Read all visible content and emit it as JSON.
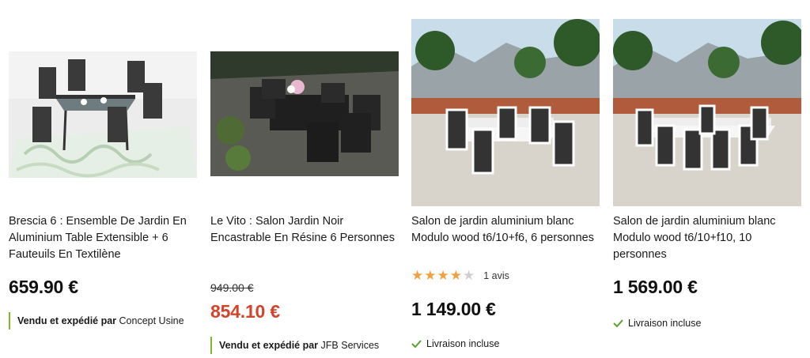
{
  "products": [
    {
      "title": "Brescia 6 : Ensemble De Jardin En Aluminium Table Extensible + 6 Fauteuils En Textilène",
      "price": "659.90 €",
      "seller_prefix": "Vendu et expédié par",
      "seller_name": "Concept Usine"
    },
    {
      "title": "Le Vito : Salon Jardin Noir Encastrable En Résine 6 Personnes",
      "old_price": "949.00 €",
      "price": "854.10 €",
      "seller_prefix": "Vendu et expédié par",
      "seller_name": "JFB Services"
    },
    {
      "title": "Salon de jardin aluminium blanc Modulo wood t6/10+f6, 6 personnes",
      "rating": 4,
      "rating_max": 5,
      "reviews": "1 avis",
      "price": "1 149.00 €",
      "delivery": "Livraison incluse"
    },
    {
      "title": "Salon de jardin aluminium blanc Modulo wood t6/10+f10, 10 personnes",
      "price": "1 569.00 €",
      "delivery": "Livraison incluse"
    }
  ],
  "colors": {
    "sale": "#d2442c",
    "seller_bar": "#7dbb2a",
    "star": "#f0a040",
    "check": "#5aa02c"
  }
}
